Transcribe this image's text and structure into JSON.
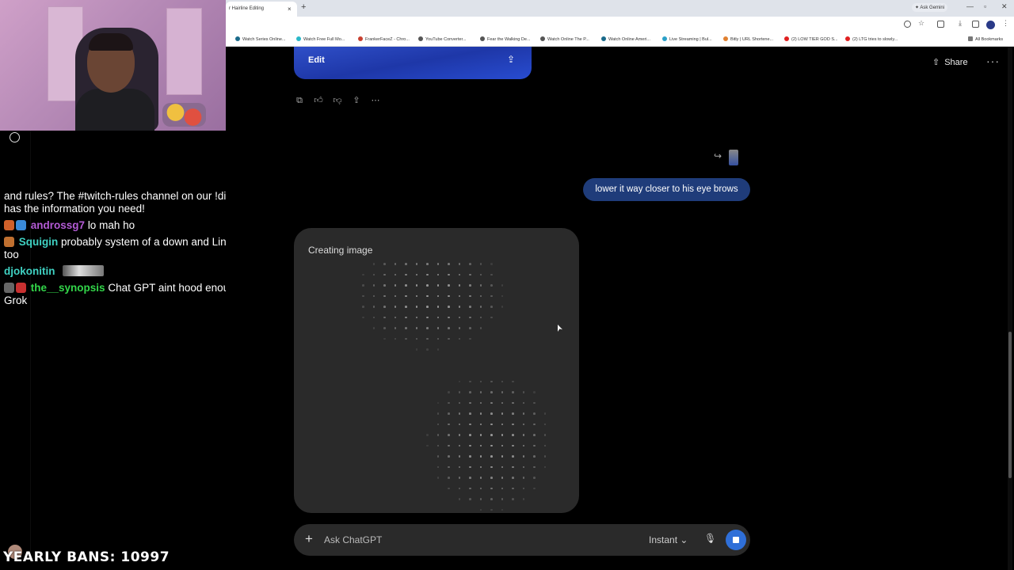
{
  "browser": {
    "tab_title": "r Hairline Editing",
    "tab_close": "×",
    "new_tab": "+",
    "ask_gemini": "✦ Ask Gemini",
    "bookmarks": [
      "Watch Series Online...",
      "Watch Free Full Mo...",
      "FrankerFaceZ - Chro...",
      "YouTube Converter...",
      "Fear the Walking De...",
      "Watch Online The P...",
      "Watch Online Ameri...",
      "Live Streaming | Bul...",
      "Bitly | URL Shortene...",
      "(2) LOW TIER GOD S...",
      "(2) LTG tries to slowly...",
      "All Bookmarks"
    ]
  },
  "chat": {
    "messages": [
      {
        "user": "",
        "text": "and rules? The #twitch-rules channel on our !discord has the information you need!"
      },
      {
        "user": "androssg7",
        "text": "lo mah ho"
      },
      {
        "user": "Squigin",
        "text": "probably system of a down and Linkin Park too"
      },
      {
        "user": "djokonitin",
        "text": ""
      },
      {
        "user": "the__synopsis",
        "text": "Chat GPT aint hood enough. Ask Grok"
      }
    ],
    "colors": {
      "androssg7": "#b45bd6",
      "Squigin": "#3fd1c2",
      "djokonitin": "#3fd1c2",
      "the__synopsis": "#33d64a"
    },
    "bans": "YEARLY BANS: 10997"
  },
  "chatgpt": {
    "image_edit": "Edit",
    "share": "Share",
    "more": "···",
    "user_message": "lower it way closer to his eye brows",
    "creating_title": "Creating image",
    "composer_placeholder": "Ask ChatGPT",
    "model": "Instant",
    "accent": "#2f6fd8"
  }
}
